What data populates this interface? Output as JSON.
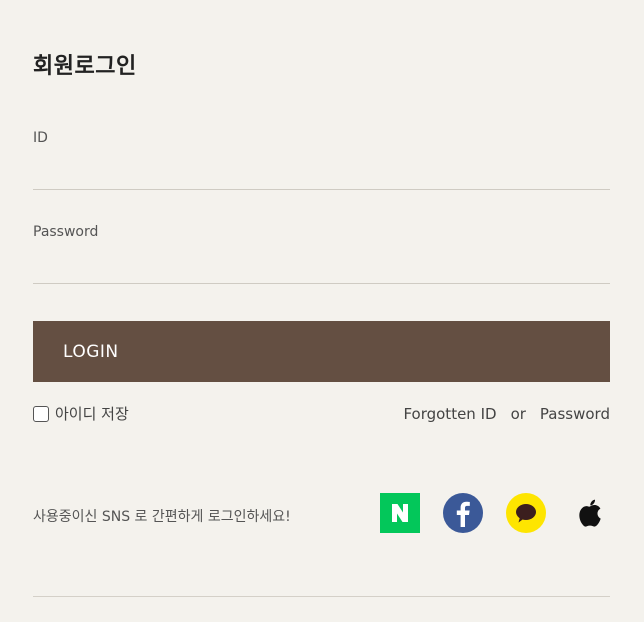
{
  "page": {
    "title": "회원로그인"
  },
  "form": {
    "id_label": "ID",
    "id_value": "",
    "password_label": "Password",
    "password_value": "",
    "login_label": "LOGIN"
  },
  "options": {
    "save_id_label": "아이디 저장",
    "save_id_checked": false,
    "forgotten_id_label": "Forgotten ID",
    "or_label": "or",
    "password_link_label": "Password"
  },
  "sns": {
    "text": "사용중이신 SNS 로 간편하게 로그인하세요!",
    "providers": [
      {
        "name": "naver",
        "icon": "naver-icon",
        "letter": "N",
        "color": "#03c75a"
      },
      {
        "name": "facebook",
        "icon": "facebook-icon",
        "letter": "f",
        "color": "#3b5998"
      },
      {
        "name": "kakao",
        "icon": "kakao-icon",
        "color": "#fee500"
      },
      {
        "name": "apple",
        "icon": "apple-icon",
        "color": "#111111"
      }
    ]
  },
  "colors": {
    "background": "#f4f2ed",
    "login_button": "#644f42",
    "divider": "#cfcbc3"
  }
}
